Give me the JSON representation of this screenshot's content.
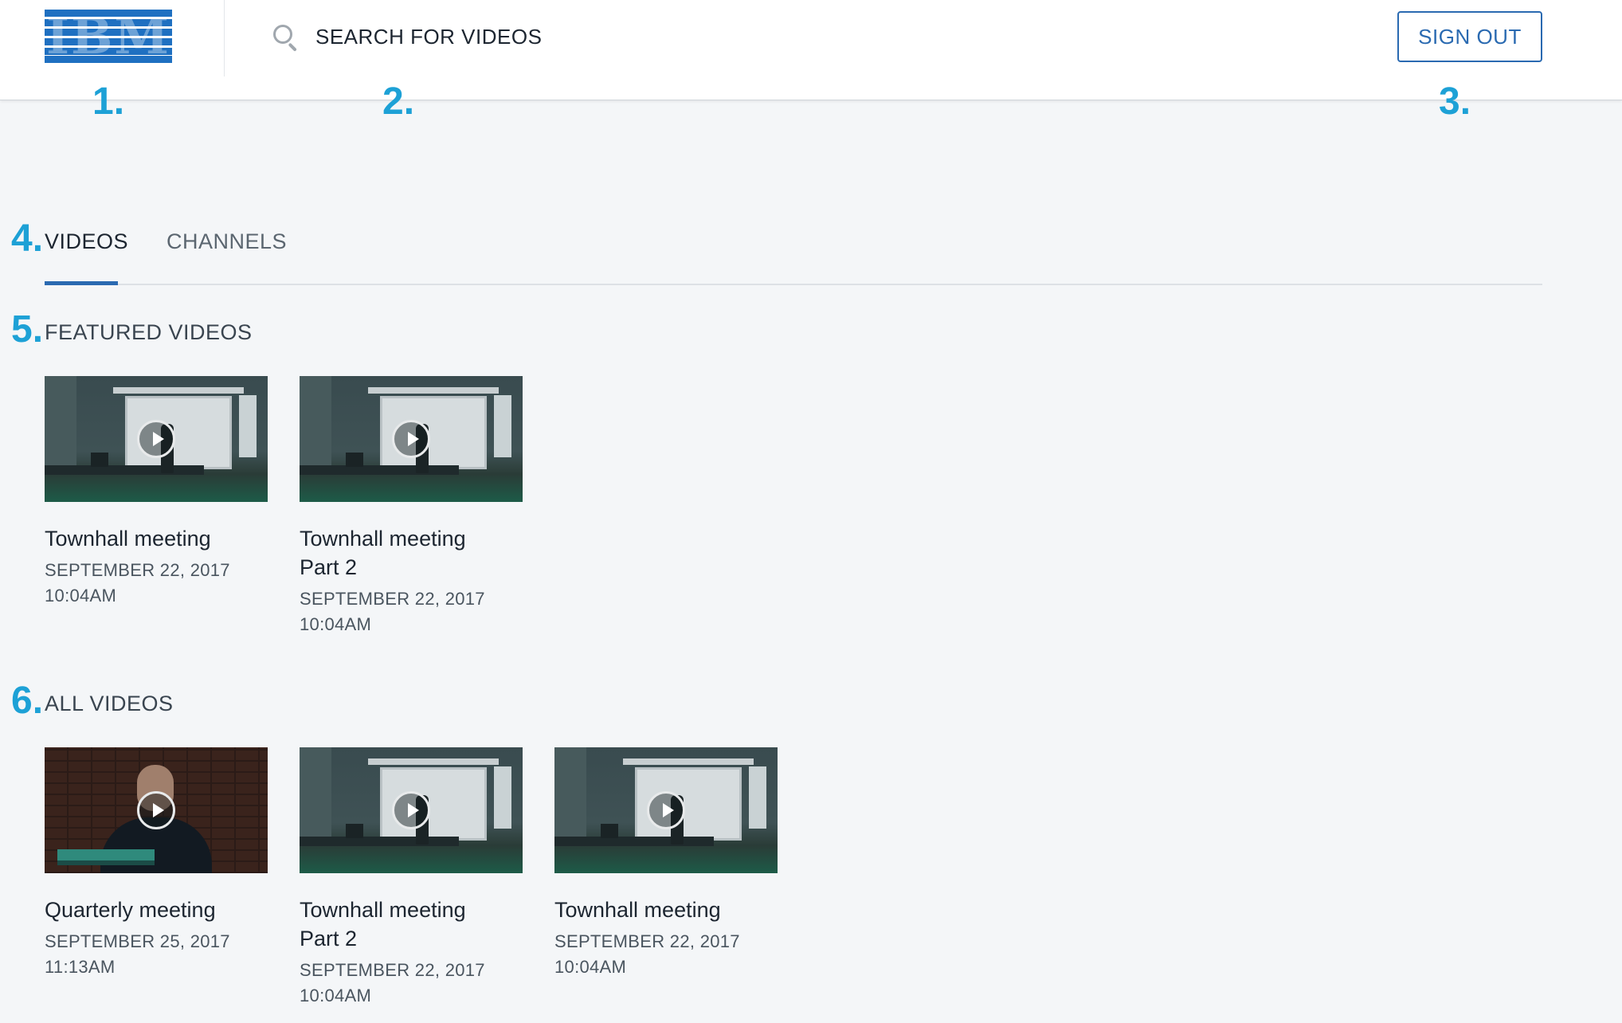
{
  "header": {
    "logo_text": "IBM",
    "search": {
      "placeholder": "SEARCH FOR VIDEOS",
      "icon": "search-icon"
    },
    "sign_out_label": "SIGN OUT"
  },
  "annotations": [
    "1.",
    "2.",
    "3.",
    "4.",
    "5.",
    "6."
  ],
  "tabs": [
    {
      "label": "VIDEOS",
      "active": true
    },
    {
      "label": "CHANNELS",
      "active": false
    }
  ],
  "featured": {
    "title": "FEATURED VIDEOS",
    "videos": [
      {
        "title": "Townhall meeting",
        "date": "SEPTEMBER 22, 2017",
        "time": "10:04AM"
      },
      {
        "title": "Townhall meeting Part 2",
        "date": "SEPTEMBER 22, 2017",
        "time": "10:04AM"
      }
    ]
  },
  "all": {
    "title": "ALL VIDEOS",
    "videos": [
      {
        "title": "Quarterly meeting",
        "date": "SEPTEMBER 25, 2017",
        "time": "11:13AM"
      },
      {
        "title": "Townhall meeting Part 2",
        "date": "SEPTEMBER 22, 2017",
        "time": "10:04AM"
      },
      {
        "title": "Townhall meeting",
        "date": "SEPTEMBER 22, 2017",
        "time": "10:04AM"
      }
    ]
  },
  "colors": {
    "accent": "#2a6ab1",
    "annotation": "#1da1d6",
    "logo_blue": "#1f70c1"
  }
}
